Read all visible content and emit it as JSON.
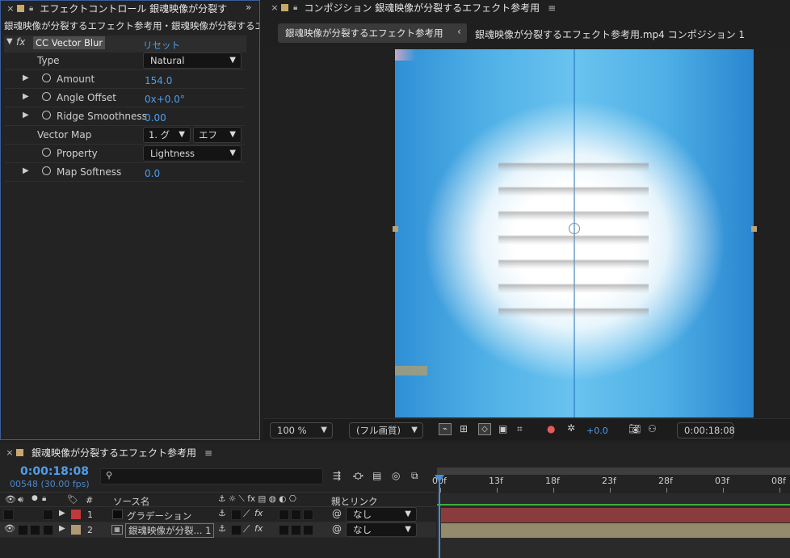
{
  "effect_panel": {
    "tab_title": "エフェクトコントロール 銀魂映像が分裂す",
    "subtitle": "銀魂映像が分裂するエフェクト参考用・銀魂映像が分裂するエフェクト",
    "effect_name": "CC Vector Blur",
    "reset_label": "リセット",
    "fx_label": "fx",
    "props": {
      "type_label": "Type",
      "type_value": "Natural",
      "amount_label": "Amount",
      "amount_value": "154.0",
      "angle_label": "Angle Offset",
      "angle_value": "0x+0.0°",
      "ridge_label": "Ridge Smoothness",
      "ridge_value": "0.00",
      "vector_map_label": "Vector Map",
      "vector_map_layer": "1. グ",
      "vector_map_mode": "エフ",
      "property_label": "Property",
      "property_value": "Lightness",
      "map_softness_label": "Map Softness",
      "map_softness_value": "0.0"
    }
  },
  "comp_panel": {
    "tab_title": "コンポジション 銀魂映像が分裂するエフェクト参考用",
    "comp_button": "銀魂映像が分裂するエフェクト参考用",
    "breadcrumb": "銀魂映像が分裂するエフェクト参考用.mp4 コンポジション 1",
    "zoom": "100 %",
    "resolution": "(フル画質)",
    "exposure": "+0.0",
    "timecode": "0:00:18:08"
  },
  "timeline": {
    "tab_title": "銀魂映像が分裂するエフェクト参考用",
    "current_time": "0:00:18:08",
    "frame_info": "00548 (30.00 fps)",
    "search_placeholder": "",
    "ruler": [
      "00f",
      "13f",
      "18f",
      "23f",
      "28f",
      "03f",
      "08f"
    ],
    "col_hash": "#",
    "col_source": "ソース名",
    "col_parent": "親とリンク",
    "layers": [
      {
        "num": "1",
        "name": "グラデーション",
        "parent": "なし",
        "color": "#c0393b"
      },
      {
        "num": "2",
        "name": "銀魂映像が分裂... 1",
        "parent": "なし",
        "color": "#b09a72"
      }
    ]
  },
  "colors": {
    "accent": "#4c9ef0",
    "label_red": "#c0393b",
    "label_tan": "#b09a72",
    "bar_red": "#8a3c3c",
    "bar_tan": "#948a6c"
  }
}
